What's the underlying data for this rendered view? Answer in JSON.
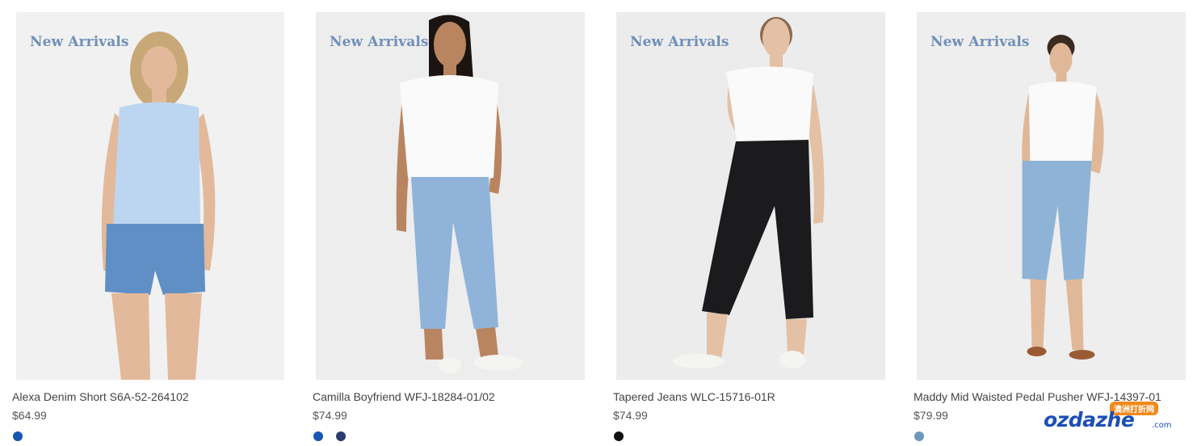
{
  "products": [
    {
      "badge": "New Arrivals",
      "name": "Alexa Denim Short S6A-52-264102",
      "price": "$64.99",
      "swatches": [
        "#1a56b3"
      ],
      "colors": {
        "top": "#bcd6f2",
        "bottom": "#5f8fc4",
        "skin": "#e2b99a",
        "hair": "#c9a878",
        "shoes": "none"
      }
    },
    {
      "badge": "New Arrivals",
      "name": "Camilla Boyfriend WFJ-18284-01/02",
      "price": "$74.99",
      "swatches": [
        "#1a56b3",
        "#2a3d6e"
      ],
      "colors": {
        "top": "#fafafa",
        "bottom": "#8fb3d9",
        "skin": "#b98561",
        "hair": "#1c1410",
        "shoes": "#f4f4f0"
      }
    },
    {
      "badge": "New Arrivals",
      "name": "Tapered Jeans WLC-15716-01R",
      "price": "$74.99",
      "swatches": [
        "#111111"
      ],
      "colors": {
        "top": "#fafafa",
        "bottom": "#1b1b1d",
        "skin": "#e4c0a4",
        "hair": "#8a6a50",
        "shoes": "#f4f4f0"
      }
    },
    {
      "badge": "New Arrivals",
      "name": "Maddy Mid Waisted Pedal Pusher WFJ-14397-01",
      "price": "$79.99",
      "swatches": [
        "#6d97bd"
      ],
      "colors": {
        "top": "#fafafa",
        "bottom": "#8fb3d6",
        "skin": "#e0b898",
        "hair": "#3b2a20",
        "shoes": "#9a5a34"
      }
    }
  ],
  "watermark": {
    "brand": "ozdazhe",
    "suffix": ".com",
    "tag": "澳洲打折网"
  }
}
